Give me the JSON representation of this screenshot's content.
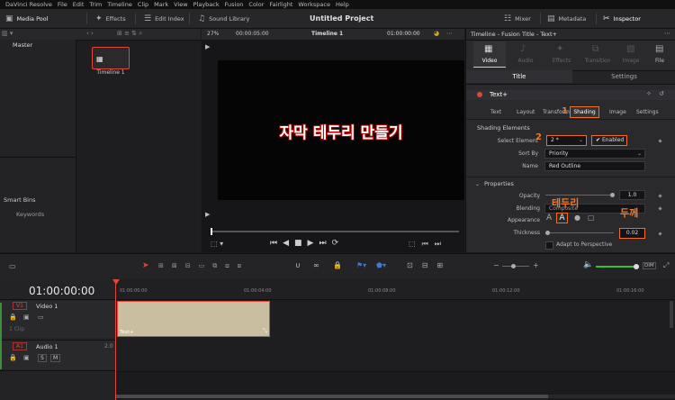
{
  "menubar": [
    "DaVinci Resolve",
    "File",
    "Edit",
    "Trim",
    "Timeline",
    "Clip",
    "Mark",
    "View",
    "Playback",
    "Fusion",
    "Color",
    "Fairlight",
    "Workspace",
    "Help"
  ],
  "toolbar": {
    "media_pool": "Media Pool",
    "effects": "Effects",
    "edit_index": "Edit Index",
    "sound_library": "Sound Library",
    "project_title": "Untitled Project",
    "mixer": "Mixer",
    "metadata": "Metadata",
    "inspector": "Inspector"
  },
  "media": {
    "bin_master": "Master",
    "clip_name": "Timeline 1",
    "smart_bins": "Smart Bins",
    "keywords": "Keywords"
  },
  "viewer": {
    "zoom": "27%",
    "timecode": "00:00:05:00",
    "timeline_name": "Timeline 1",
    "current_tc": "01:00:00:00",
    "subtitle": "자막 테두리 만들기"
  },
  "inspector": {
    "header": "Timeline - Fusion Title - Text+",
    "top_tabs": [
      "Video",
      "Audio",
      "Effects",
      "Transition",
      "Image",
      "File"
    ],
    "sub_tabs": [
      "Title",
      "Settings"
    ],
    "node_name": "Text+",
    "text_tabs": [
      "Text",
      "Layout",
      "Transform",
      "Shading",
      "Image",
      "Settings"
    ],
    "shading_section": "Shading Elements",
    "select_element_label": "Select Element",
    "select_element_value": "2 *",
    "enabled_label": "Enabled",
    "sort_by_label": "Sort By",
    "sort_by_value": "Priority",
    "name_label": "Name",
    "name_value": "Red Outline",
    "properties_section": "Properties",
    "opacity_label": "Opacity",
    "opacity_value": "1.0",
    "blending_label": "Blending",
    "blending_value": "Composite",
    "appearance_label": "Appearance",
    "thickness_label": "Thickness",
    "thickness_value": "0.02",
    "adapt_label": "Adapt to Perspective",
    "annotations": {
      "n1": "1",
      "n2": "2",
      "outline": "테두리",
      "thickness": "두께"
    }
  },
  "timeline": {
    "timecode": "01:00:00:00",
    "ruler": [
      "01:00:00:00",
      "01:00:04:00",
      "01:00:08:00",
      "01:00:12:00",
      "01:00:16:00"
    ],
    "video_track": {
      "id": "V1",
      "name": "Video 1",
      "clip_count": "1 Clip",
      "clip_label": "Text+"
    },
    "audio_track": {
      "id": "A1",
      "name": "Audio 1",
      "level": "2.0",
      "s_btn": "S",
      "m_btn": "M"
    },
    "dim": "DIM"
  },
  "colors": {
    "accent_orange": "#f26e22",
    "clip": "#c9bfa0",
    "playhead": "#e0463a"
  }
}
